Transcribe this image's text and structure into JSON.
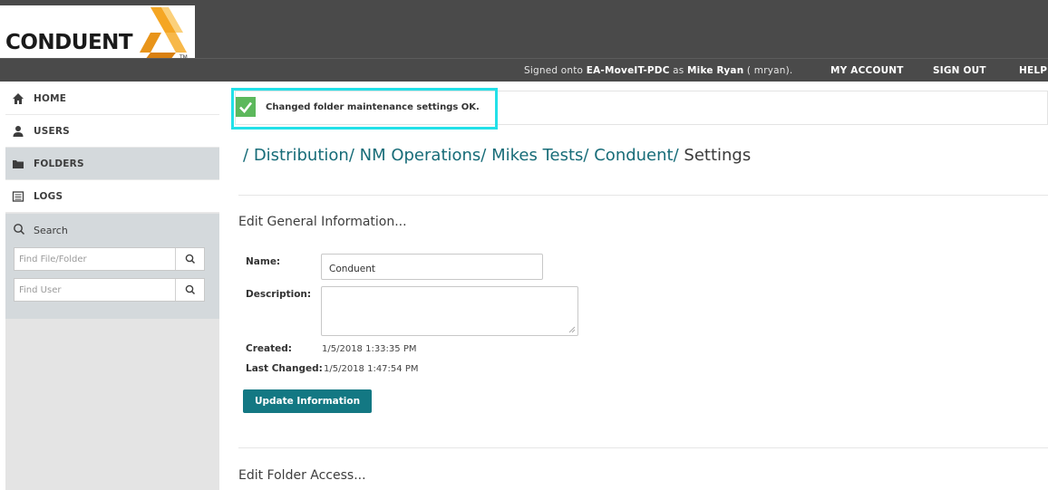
{
  "brand": {
    "logo_text": "CONDUENT",
    "logo_mark": "ribbon-logo-icon",
    "trademark": "TM",
    "accent_color": "#f5a623"
  },
  "header": {
    "signed_prefix": "Signed onto",
    "server": "EA-MoveIT-PDC",
    "as_word": "as",
    "user_display": "Mike Ryan",
    "user_login": " ( mryan).",
    "nav": [
      "MY ACCOUNT",
      "SIGN OUT",
      "HELP"
    ]
  },
  "sidebar": {
    "items": [
      {
        "label": "HOME",
        "icon": "home-icon"
      },
      {
        "label": "USERS",
        "icon": "user-icon"
      },
      {
        "label": "FOLDERS",
        "icon": "folder-icon"
      },
      {
        "label": "LOGS",
        "icon": "list-icon"
      }
    ],
    "search": {
      "title": "Search",
      "file_placeholder": "Find File/Folder",
      "user_placeholder": "Find User"
    }
  },
  "flash": {
    "message": "Changed folder maintenance settings OK.",
    "status_color": "#5cb85c"
  },
  "breadcrumb": {
    "crumbs": [
      "Distribution/",
      "NM Operations/",
      "Mikes Tests/",
      "Conduent/"
    ],
    "lead": "/",
    "current": "Settings"
  },
  "general": {
    "title": "Edit General Information...",
    "name_label": "Name:",
    "name_value": "Conduent",
    "description_label": "Description:",
    "description_value": "",
    "created_label": "Created:",
    "created_value": "1/5/2018 1:33:35 PM",
    "changed_label": "Last Changed:",
    "changed_value": "1/5/2018 1:47:54 PM",
    "update_button": "Update Information"
  },
  "access": {
    "title": "Edit Folder Access..."
  },
  "colors": {
    "teal": "#137883",
    "link": "#176c78",
    "topbar": "#4a4a4a",
    "highlight": "#22e0e8"
  }
}
